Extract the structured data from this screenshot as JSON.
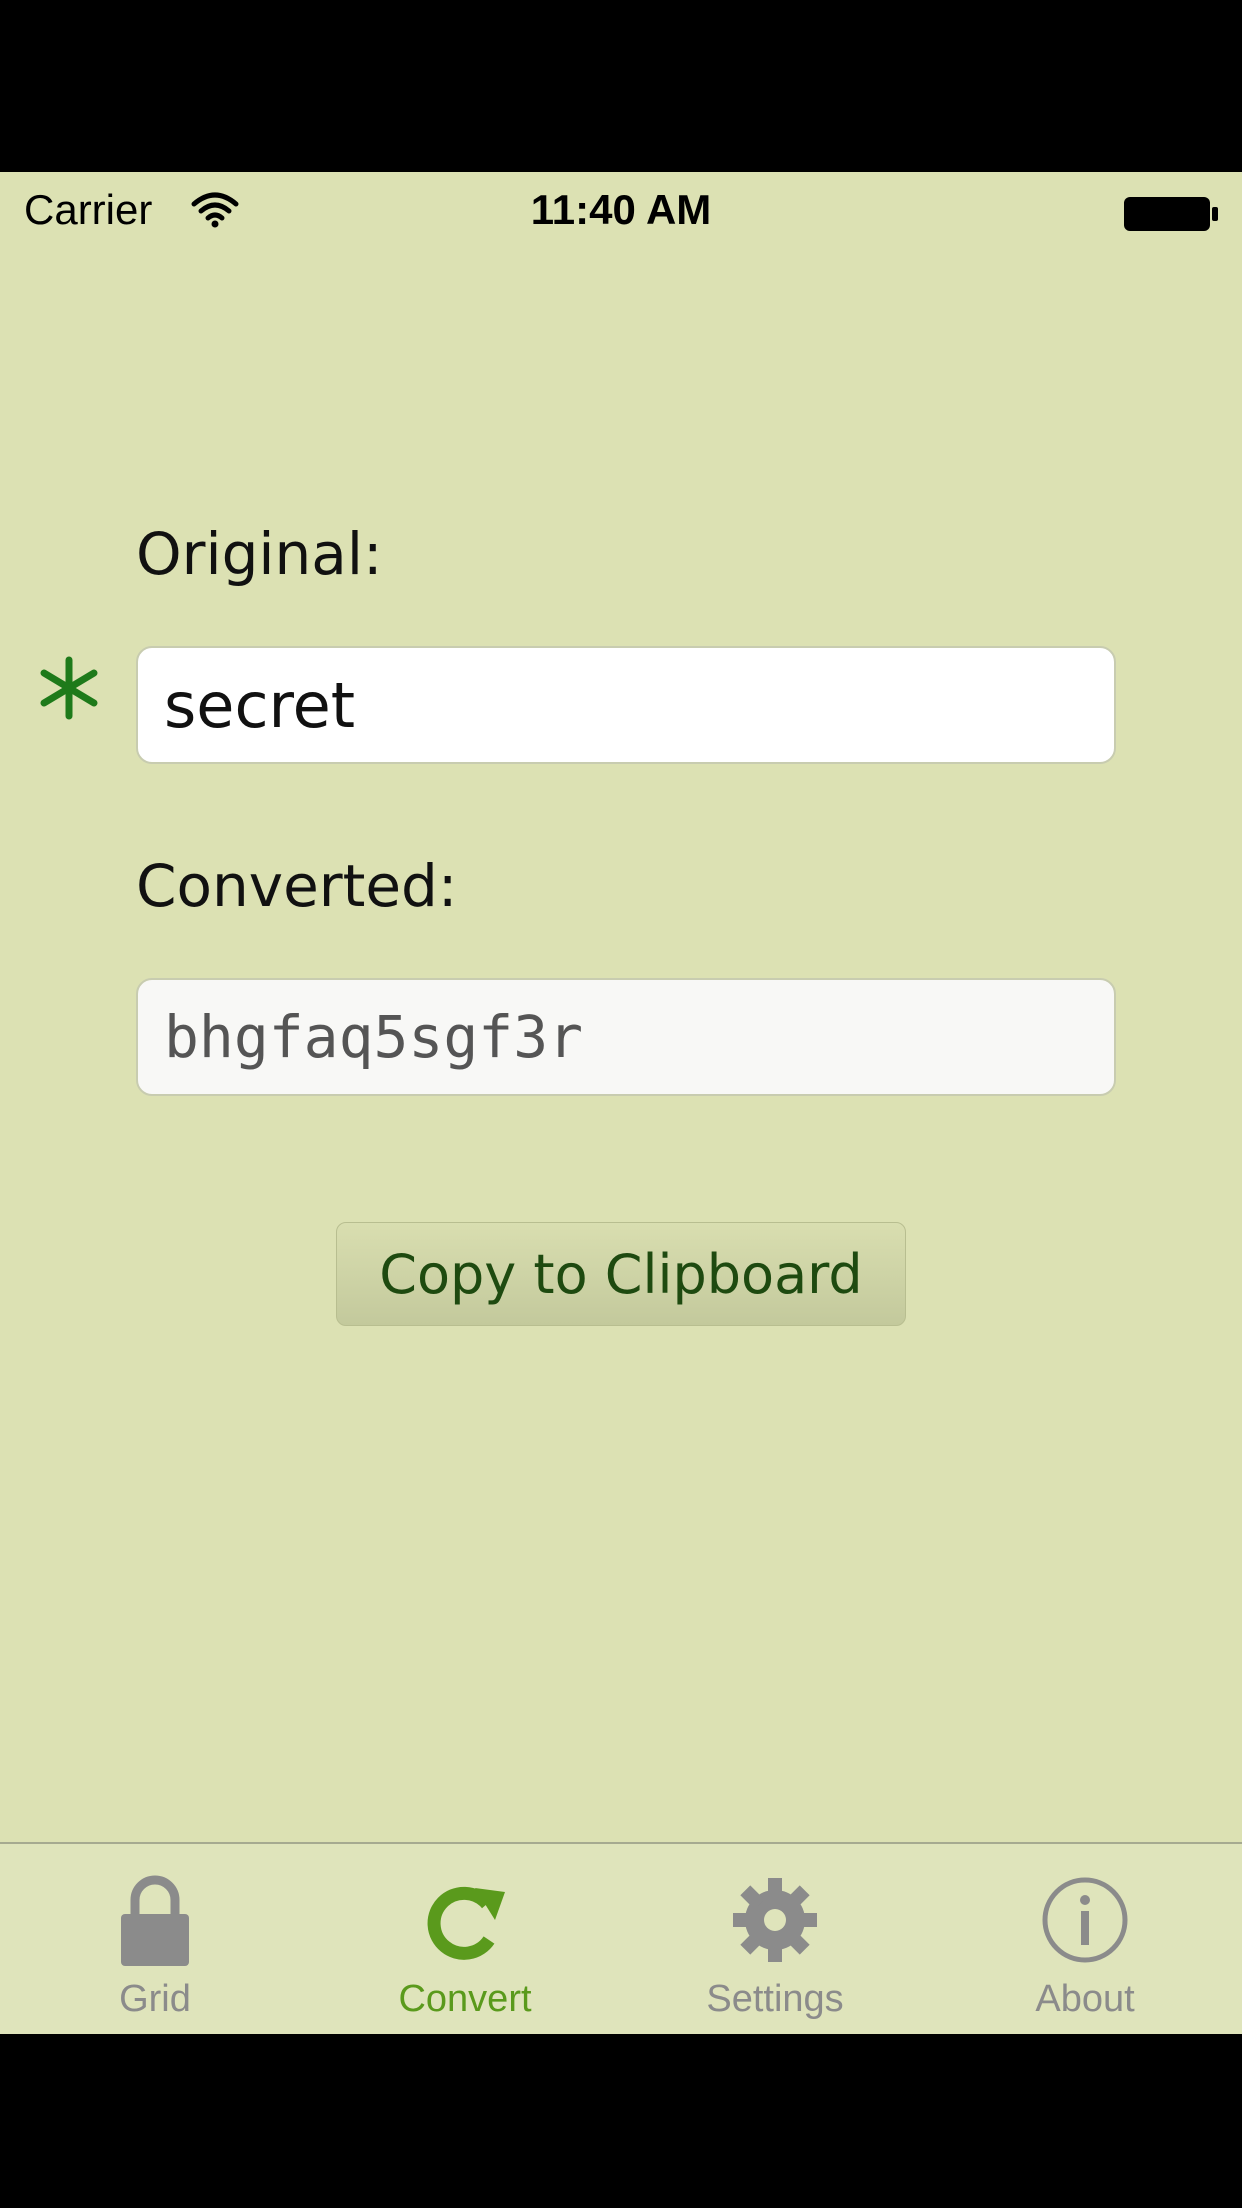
{
  "status_bar": {
    "carrier": "Carrier",
    "time": "11:40 AM"
  },
  "form": {
    "original_label": "Original:",
    "original_value": "secret",
    "converted_label": "Converted:",
    "converted_value": "bhgfaq5sgf3r",
    "copy_button_label": "Copy to Clipboard"
  },
  "tab_bar": {
    "selected": "Convert",
    "tabs": [
      {
        "label": "Grid",
        "icon": "lock-icon"
      },
      {
        "label": "Convert",
        "icon": "refresh-arrow-icon"
      },
      {
        "label": "Settings",
        "icon": "gear-icon"
      },
      {
        "label": "About",
        "icon": "info-icon"
      }
    ]
  },
  "colors": {
    "background": "#dce1b3",
    "accent": "#5a9a1c",
    "asterisk": "#1e7a1a",
    "inactive_tab": "#8b8b8b"
  }
}
